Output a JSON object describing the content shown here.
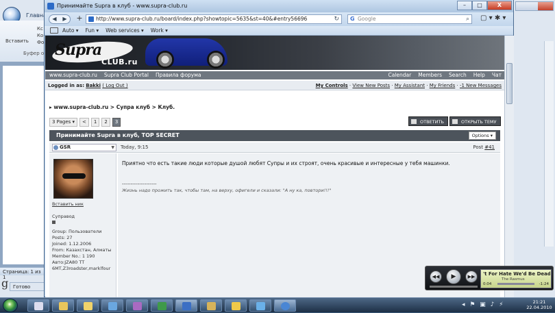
{
  "word": {
    "tab": "Главна",
    "ribbon_paste": "Вставить",
    "ribbon_k1": "Кс",
    "ribbon_k2": "Ко",
    "ribbon_f": "Фо",
    "group_label": "Буфер об",
    "status": "Страница: 1 из 1",
    "glyph": "g",
    "ready": "Готово"
  },
  "browser": {
    "title": "Принимайте Supra в клуб - www.supra-club.ru",
    "win_min": "–",
    "win_max": "□",
    "win_close": "X",
    "back": "◀",
    "forward": "▶",
    "new_tab": "+",
    "url": "http://www.supra-club.ru/board/index.php?showtopic=5635&st=40&#entry56696",
    "refresh": "↻",
    "search_placeholder": "Google",
    "search_g": "G",
    "search_btn": "⌕",
    "tools": "▢ ▾  ✱ ▾",
    "bookmarks": [
      "Auto ▾",
      "Fun ▾",
      "Web services ▾",
      "Work ▾"
    ]
  },
  "site": {
    "logo": "Supra",
    "logo_sub": "CLUB.ru",
    "nav_left": [
      "www.supra-club.ru",
      "Supra Club Portal",
      "Правила форума"
    ],
    "nav_right": [
      "Calendar",
      "Members",
      "Search",
      "Help",
      "Чат"
    ],
    "logged_label": "Logged in as:",
    "username": "Bakki",
    "logout": "( Log Out )",
    "user_links": [
      "My Controls",
      "View New Posts",
      "My Assistant",
      "My Friends",
      "-1 New Messages"
    ],
    "sep": " · ",
    "breadcrumb": "▸ www.supra-club.ru > Супра клуб > Клуб.",
    "pages_label": "3 Pages ▾",
    "page_prev": "<",
    "pages": [
      "1",
      "2",
      "3"
    ],
    "btn_reply": "ОТВЕТИТЬ",
    "btn_new_topic": "ОТКРЫТЬ ТЕМУ",
    "topic_title": "Принимайте Supra в клуб, TOP SECRET",
    "options": "Options ▾"
  },
  "post": {
    "author": "GSR",
    "author_caret": "▼",
    "date": "Today, 9:15",
    "post_label": "Post ",
    "post_number": "#41",
    "insert_nick": "Вставить ник",
    "rank": "Суправод",
    "info": [
      "Group: Пользователи",
      "Posts: 27",
      "Joined: 1.12.2006",
      "From: Казахстан, Алматы",
      "Member No.: 1 190",
      "Авто:JZA80 TT",
      "6MT,Z3roadster,marklfour"
    ],
    "text": "Приятно что есть такие люди которые душой любят Супры и их строят, очень красивые и интересные у тебя машинки.",
    "sig_line": "--------------------",
    "signature": "Жизнь надо прожить так, чтобы там, на верху, офигели и сказали: \"А ну ка, повтори!!!\""
  },
  "player": {
    "prev": "◀◀",
    "play": "▶",
    "next": "▶▶",
    "track": "'t For Hate We'd Be Dead By I",
    "artist": "The Rasmus",
    "time_elapsed": "0:04",
    "time_remaining": "-1:24"
  },
  "taskbar": {
    "tray": "◂ ⚑ ▣ ♪ ⚡",
    "time": "21:21",
    "date": "22.04.2010"
  }
}
